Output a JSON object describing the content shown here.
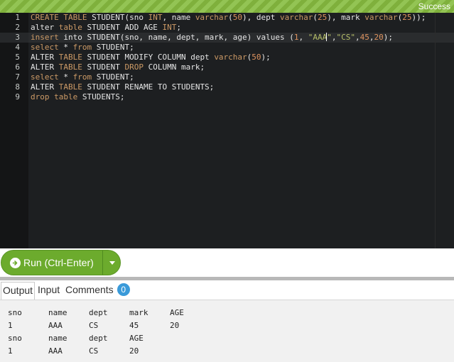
{
  "status": {
    "text": "Success"
  },
  "editor": {
    "line_numbers": [
      "1",
      "2",
      "3",
      "4",
      "5",
      "6",
      "7",
      "8",
      "9"
    ],
    "lines": [
      [
        [
          "kw",
          "CREATE TABLE"
        ],
        [
          "t",
          " STUDENT(sno "
        ],
        [
          "kw",
          "INT"
        ],
        [
          "t",
          ", name "
        ],
        [
          "kw",
          "varchar"
        ],
        [
          "t",
          "("
        ],
        [
          "num",
          "50"
        ],
        [
          "t",
          "), dept "
        ],
        [
          "kw",
          "varchar"
        ],
        [
          "t",
          "("
        ],
        [
          "num",
          "25"
        ],
        [
          "t",
          "), mark "
        ],
        [
          "kw",
          "varchar"
        ],
        [
          "t",
          "("
        ],
        [
          "num",
          "25"
        ],
        [
          "t",
          "));"
        ]
      ],
      [
        [
          "t",
          "alter "
        ],
        [
          "kw",
          "table"
        ],
        [
          "t",
          " STUDENT ADD AGE "
        ],
        [
          "kw",
          "INT"
        ],
        [
          "t",
          ";"
        ]
      ],
      [
        [
          "kw",
          "insert"
        ],
        [
          "t",
          " into STUDENT(sno, name, dept, mark, age) values ("
        ],
        [
          "num",
          "1"
        ],
        [
          "t",
          ", "
        ],
        [
          "str",
          "\"AAA"
        ],
        [
          "cursor",
          ""
        ],
        [
          "str",
          "\""
        ],
        [
          "t",
          ","
        ],
        [
          "str",
          "\"CS\""
        ],
        [
          "t",
          ","
        ],
        [
          "num",
          "45"
        ],
        [
          "t",
          ","
        ],
        [
          "num",
          "20"
        ],
        [
          "t",
          ");"
        ]
      ],
      [
        [
          "kw",
          "select"
        ],
        [
          "t",
          " * "
        ],
        [
          "kw",
          "from"
        ],
        [
          "t",
          " STUDENT;"
        ]
      ],
      [
        [
          "t",
          "ALTER "
        ],
        [
          "kw",
          "TABLE"
        ],
        [
          "t",
          " STUDENT MODIFY COLUMN dept "
        ],
        [
          "kw",
          "varchar"
        ],
        [
          "t",
          "("
        ],
        [
          "num",
          "50"
        ],
        [
          "t",
          ");"
        ]
      ],
      [
        [
          "t",
          "ALTER "
        ],
        [
          "kw",
          "TABLE"
        ],
        [
          "t",
          " STUDENT "
        ],
        [
          "kw",
          "DROP"
        ],
        [
          "t",
          " COLUMN mark;"
        ]
      ],
      [
        [
          "kw",
          "select"
        ],
        [
          "t",
          " * "
        ],
        [
          "kw",
          "from"
        ],
        [
          "t",
          " STUDENT;"
        ]
      ],
      [
        [
          "t",
          "ALTER "
        ],
        [
          "kw",
          "TABLE"
        ],
        [
          "t",
          " STUDENT RENAME TO STUDENTS;"
        ]
      ],
      [
        [
          "kw",
          "drop"
        ],
        [
          "t",
          " "
        ],
        [
          "kw",
          "table"
        ],
        [
          "t",
          " STUDENTS;"
        ]
      ]
    ]
  },
  "run_button": {
    "label": "Run (Ctrl-Enter)"
  },
  "tabs": {
    "output": "Output",
    "input": "Input",
    "comments": "Comments",
    "comments_count": "0"
  },
  "output": {
    "rows": [
      [
        "sno",
        "name",
        "dept",
        "mark",
        "AGE"
      ],
      [
        "1",
        "AAA",
        "CS",
        "45",
        "20"
      ],
      [
        "sno",
        "name",
        "dept",
        "AGE"
      ],
      [
        "1",
        "AAA",
        "CS",
        "20"
      ]
    ]
  },
  "colors": {
    "status_bar": "#7fb03c",
    "editor_bg": "#1d1f21",
    "keyword": "#cc9a66",
    "number": "#de935f",
    "string": "#b5bd68",
    "run_button": "#6cab2d",
    "badge": "#3a9ad9"
  }
}
